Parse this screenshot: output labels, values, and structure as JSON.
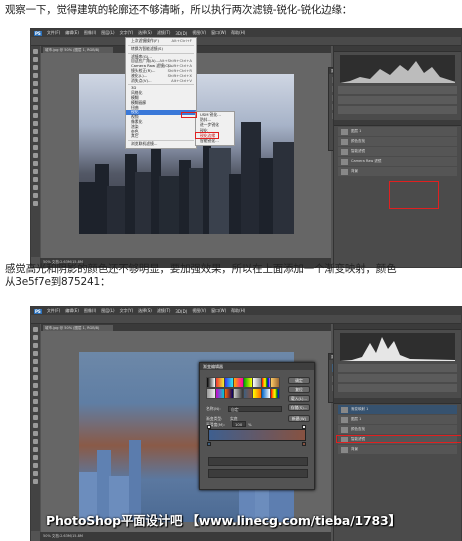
{
  "captions": {
    "step1": "观察一下，觉得建筑的轮廓还不够清晰，所以执行两次滤镜-锐化-锐化边缘：",
    "step2_line1": "感觉高光和阴影的颜色还不够明显，要加强效果，所以在上面添加一个渐变映射，颜色",
    "step2_line2": "从3e5f7e到875241："
  },
  "screenshot1": {
    "menubar": [
      "PS",
      "文件(F)",
      "编辑(E)",
      "图像(I)",
      "图层(L)",
      "文字(Y)",
      "选择(S)",
      "滤镜(T)",
      "3D(D)",
      "视图(V)",
      "窗口(W)",
      "帮助(H)"
    ],
    "doc_tab": "城市.jpg @ 50% (图层 1, RGB/8)",
    "status": "50%   文档:2.63M/15.8M",
    "filter_menu": [
      {
        "label": "上次滤镜操作(F)",
        "shortcut": "Alt+Ctrl+F"
      },
      {
        "sep": true
      },
      {
        "label": "转换为智能滤镜(S)",
        "shortcut": ""
      },
      {
        "sep": true
      },
      {
        "label": "滤镜库(G)...",
        "shortcut": ""
      },
      {
        "label": "自适应广角(A)...",
        "shortcut": "Alt+Shift+Ctrl+A"
      },
      {
        "label": "Camera Raw 滤镜(C)...",
        "shortcut": "Shift+Ctrl+A"
      },
      {
        "label": "镜头校正(R)...",
        "shortcut": "Shift+Ctrl+R"
      },
      {
        "label": "液化(L)...",
        "shortcut": "Shift+Ctrl+X"
      },
      {
        "label": "消失点(V)...",
        "shortcut": "Alt+Ctrl+V"
      },
      {
        "sep": true
      },
      {
        "label": "3D",
        "shortcut": ""
      },
      {
        "label": "风格化",
        "shortcut": ""
      },
      {
        "label": "模糊",
        "shortcut": ""
      },
      {
        "label": "模糊画廊",
        "shortcut": ""
      },
      {
        "label": "扭曲",
        "shortcut": ""
      },
      {
        "label": "锐化",
        "shortcut": "",
        "highlighted": true
      },
      {
        "label": "视频",
        "shortcut": ""
      },
      {
        "label": "像素化",
        "shortcut": ""
      },
      {
        "label": "渲染",
        "shortcut": ""
      },
      {
        "label": "杂色",
        "shortcut": ""
      },
      {
        "label": "其它",
        "shortcut": ""
      },
      {
        "sep": true
      },
      {
        "label": "浏览联机滤镜...",
        "shortcut": ""
      }
    ],
    "sharpen_submenu": [
      "USM 锐化...",
      "防抖...",
      "进一步锐化",
      "锐化",
      "锐化边缘",
      "智能锐化..."
    ],
    "sharpen_submenu_selected": "锐化边缘",
    "properties_title": "属性",
    "layers": [
      {
        "name": "图层 1",
        "selected": false
      },
      {
        "name": "颜色查找",
        "selected": false
      },
      {
        "name": "智能滤镜",
        "selected": false
      },
      {
        "name": "Camera Raw 滤镜",
        "selected": false
      },
      {
        "name": "背景",
        "selected": false
      }
    ]
  },
  "screenshot2": {
    "dialog_title": "渐变编辑器",
    "buttons": [
      "确定",
      "复位",
      "载入(L)...",
      "存储(S)..."
    ],
    "name_label": "名称(N):",
    "name_value": "自定",
    "new_button": "新建(W)",
    "gradient_type_label": "渐变类型:",
    "gradient_type_value": "实底",
    "smoothness_label": "平滑度(M):",
    "smoothness_value": "100",
    "smoothness_unit": "%",
    "color_stops": [
      "3e5f7e",
      "875241"
    ],
    "layers": [
      {
        "name": "渐变映射 1",
        "selected": true
      },
      {
        "name": "图层 1",
        "selected": false
      },
      {
        "name": "颜色查找",
        "selected": false
      },
      {
        "name": "智能滤镜",
        "selected": false
      },
      {
        "name": "背景",
        "selected": false
      }
    ]
  },
  "watermark": "PhotoShop平面设计吧 【www.linecg.com/tieba/1783】",
  "colors": {
    "stop_start": "#3e5f7e",
    "stop_end": "#875241",
    "highlight_red": "#e02020",
    "menu_highlight": "#3a78d8"
  }
}
